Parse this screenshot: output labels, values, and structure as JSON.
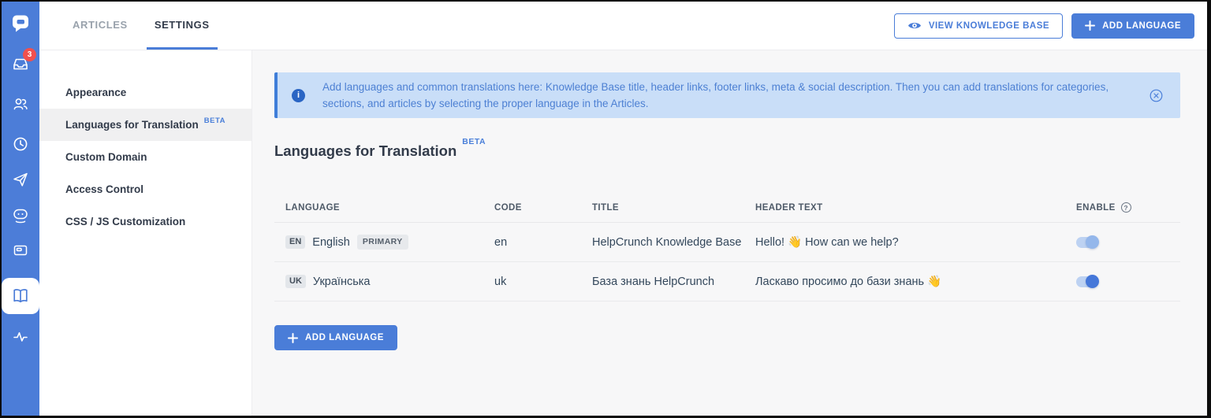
{
  "rail": {
    "inbox_badge_count": "3",
    "icons": [
      "helpcrunch-logo",
      "inbox",
      "contacts",
      "history",
      "campaigns",
      "chatbot",
      "widget",
      "knowledge-base",
      "analytics"
    ],
    "active_icon": "knowledge-base"
  },
  "topbar": {
    "tabs": [
      {
        "label": "ARTICLES",
        "active": false
      },
      {
        "label": "SETTINGS",
        "active": true
      }
    ],
    "view_kb_label": "VIEW KNOWLEDGE BASE",
    "add_language_label": "ADD LANGUAGE"
  },
  "settings_nav": {
    "items": [
      {
        "label": "Appearance",
        "active": false
      },
      {
        "label": "Languages for Translation",
        "badge": "BETA",
        "active": true
      },
      {
        "label": "Custom Domain",
        "active": false
      },
      {
        "label": "Access Control",
        "active": false
      },
      {
        "label": "CSS / JS Customization",
        "active": false
      }
    ]
  },
  "banner": {
    "icon": "info-icon",
    "text": "Add languages and common translations here: Knowledge Base title, header links, footer links, meta & social description. Then you can add translations for categories, sections, and articles by selecting the proper language in the Articles.",
    "close_icon": "circled-x"
  },
  "main": {
    "title": "Languages for Translation",
    "title_badge": "BETA",
    "add_language_label": "ADD LANGUAGE"
  },
  "table": {
    "columns": [
      "LANGUAGE",
      "CODE",
      "TITLE",
      "HEADER TEXT",
      "ENABLE"
    ],
    "rows": [
      {
        "code_badge": "EN",
        "language": "English",
        "primary_badge": "PRIMARY",
        "code": "en",
        "title": "HelpCrunch Knowledge Base",
        "header_text": "Hello! 👋 How can we help?",
        "enabled": true,
        "toggle_muted": true
      },
      {
        "code_badge": "UK",
        "language": "Українська",
        "primary_badge": null,
        "code": "uk",
        "title": "База знань HelpCrunch",
        "header_text": "Ласкаво просимо до бази знань 👋",
        "enabled": true,
        "toggle_muted": false
      }
    ]
  },
  "colors": {
    "rail_blue": "#4c7dd8",
    "accent_blue": "#4a7dd8",
    "banner_bg": "#c9def8",
    "banner_border": "#3f7ed9",
    "banner_text": "#4d80d3",
    "info_circle": "#2a65c4",
    "content_bg": "#f7f7f8",
    "heading_text": "#323b4a",
    "body_text": "#33475b",
    "notification_red": "#f1504e",
    "toggle_track": "#bdd2f2",
    "toggle_knob_on": "#4577d9",
    "toggle_knob_muted": "#94b7eb"
  }
}
